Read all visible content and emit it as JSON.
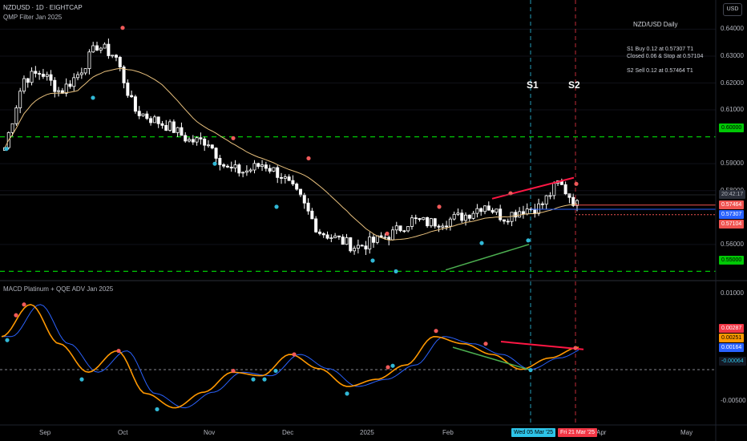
{
  "header": {
    "symbol_line": "NZDUSD · 1D · EIGHTCAP",
    "indicator_line": "QMP Filter Jan 2025",
    "currency_button": "USD"
  },
  "notes": {
    "title": "NZD/USD Daily",
    "line1": "S1 Buy 0.12 at 0.57307 T1",
    "line2": "Closed 0.06 & Stop at 0.57104",
    "line3": "S2 Sell 0.12 at 0.57464 T1"
  },
  "signals": {
    "s1": "S1",
    "s2": "S2"
  },
  "price_axis": {
    "ticks": [
      "0.64000",
      "0.63000",
      "0.62000",
      "0.61000",
      "0.59000",
      "0.58000",
      "0.56000"
    ],
    "tags": [
      {
        "text": "0.60000",
        "bg": "#00c805",
        "fg": "#000000"
      },
      {
        "text": "20:42:17",
        "bg": "#2a2e39",
        "fg": "#b2b5be"
      },
      {
        "text": "0.57464",
        "bg": "#ef5350",
        "fg": "#ffffff"
      },
      {
        "text": "0.57307",
        "bg": "#2962ff",
        "fg": "#ffffff"
      },
      {
        "text": "0.57104",
        "bg": "#ef5350",
        "fg": "#ffffff"
      },
      {
        "text": "0.55000",
        "bg": "#00c805",
        "fg": "#000000"
      }
    ]
  },
  "macd": {
    "title": "MACD Platinum + QQE ADV Jan 2025",
    "ticks": [
      "0.01000",
      "0.00500",
      "-0.00500"
    ],
    "tags": [
      {
        "text": "0.00287",
        "bg": "#f23645",
        "fg": "#ffffff"
      },
      {
        "text": "0.00251",
        "bg": "#ff9800",
        "fg": "#000000"
      },
      {
        "text": "0.00164",
        "bg": "#2962ff",
        "fg": "#ffffff"
      },
      {
        "text": "-0.00064",
        "bg": "#131722",
        "fg": "#2ec4e8"
      }
    ]
  },
  "time_axis": {
    "labels": [
      "Sep",
      "Oct",
      "Nov",
      "Dec",
      "2025",
      "Feb",
      "Apr",
      "May"
    ],
    "highlight_s1": "Wed 05 Mar '25",
    "highlight_s2": "Fri 21 Mar '25"
  },
  "colors": {
    "bg": "#000000",
    "candle": "#ffffff",
    "ma": "#e8c07d",
    "level": "#00c805",
    "resistance": "#ff1744",
    "support": "#4caf50",
    "dot_red": "#f05a5a",
    "dot_cyan": "#31b8d6",
    "macd_fast": "#ff9800",
    "macd_slow": "#2962ff"
  },
  "chart_data": [
    {
      "type": "candlestick",
      "title": "NZDUSD · 1D · EIGHTCAP",
      "ylim": [
        0.5525,
        0.6425
      ],
      "horizontal_levels": [
        0.6,
        0.55
      ],
      "series": [
        {
          "name": "close",
          "points": [
            [
              "Aug-22",
              0.596
            ],
            [
              "Aug-29",
              0.6215
            ],
            [
              "Sep-05",
              0.624
            ],
            [
              "Sep-12",
              0.6165
            ],
            [
              "Sep-19",
              0.6235
            ],
            [
              "Sep-26",
              0.634
            ],
            [
              "Oct-01",
              0.63
            ],
            [
              "Oct-10",
              0.61
            ],
            [
              "Oct-17",
              0.6065
            ],
            [
              "Oct-24",
              0.6035
            ],
            [
              "Oct-31",
              0.5985
            ],
            [
              "Nov-07",
              0.5985
            ],
            [
              "Nov-14",
              0.588
            ],
            [
              "Nov-21",
              0.587
            ],
            [
              "Nov-28",
              0.59
            ],
            [
              "Dec-05",
              0.5855
            ],
            [
              "Dec-12",
              0.577
            ],
            [
              "Dec-19",
              0.565
            ],
            [
              "Dec-26",
              0.562
            ],
            [
              "Jan-02",
              0.559
            ],
            [
              "Jan-09",
              0.561
            ],
            [
              "Jan-16",
              0.564
            ],
            [
              "Jan-23",
              0.569
            ],
            [
              "Jan-30",
              0.568
            ],
            [
              "Feb-06",
              0.569
            ],
            [
              "Feb-13",
              0.571
            ],
            [
              "Feb-20",
              0.575
            ],
            [
              "Feb-27",
              0.57
            ],
            [
              "Mar-05",
              0.573
            ],
            [
              "Mar-12",
              0.574
            ],
            [
              "Mar-18",
              0.583
            ],
            [
              "Mar-21",
              0.5746
            ]
          ]
        }
      ],
      "trade_levels": {
        "s1_buy": 0.57307,
        "stop": 0.57104,
        "s2_sell": 0.57464
      }
    },
    {
      "type": "line",
      "title": "MACD Platinum + QQE ADV Jan 2025",
      "ylim": [
        -0.0075,
        0.0105
      ],
      "series": [
        {
          "name": "MACD",
          "points": [
            [
              "Aug-22",
              0.004
            ],
            [
              "Sep-01",
              0.0085
            ],
            [
              "Sep-12",
              0.003
            ],
            [
              "Sep-20",
              -0.001
            ],
            [
              "Oct-01",
              0.002
            ],
            [
              "Oct-12",
              -0.004
            ],
            [
              "Oct-25",
              -0.006
            ],
            [
              "Nov-05",
              -0.0038
            ],
            [
              "Nov-12",
              -0.001
            ],
            [
              "Nov-25",
              -0.0015
            ],
            [
              "Dec-05",
              0.0015
            ],
            [
              "Dec-15",
              -0.0005
            ],
            [
              "Dec-28",
              -0.003
            ],
            [
              "Jan-10",
              -0.002
            ],
            [
              "Jan-20",
              0.0
            ],
            [
              "Feb-01",
              0.004
            ],
            [
              "Feb-10",
              0.003
            ],
            [
              "Feb-22",
              0.0015
            ],
            [
              "Mar-05",
              -0.0006
            ],
            [
              "Mar-14",
              0.001
            ],
            [
              "Mar-21",
              0.0025
            ]
          ]
        }
      ]
    }
  ]
}
